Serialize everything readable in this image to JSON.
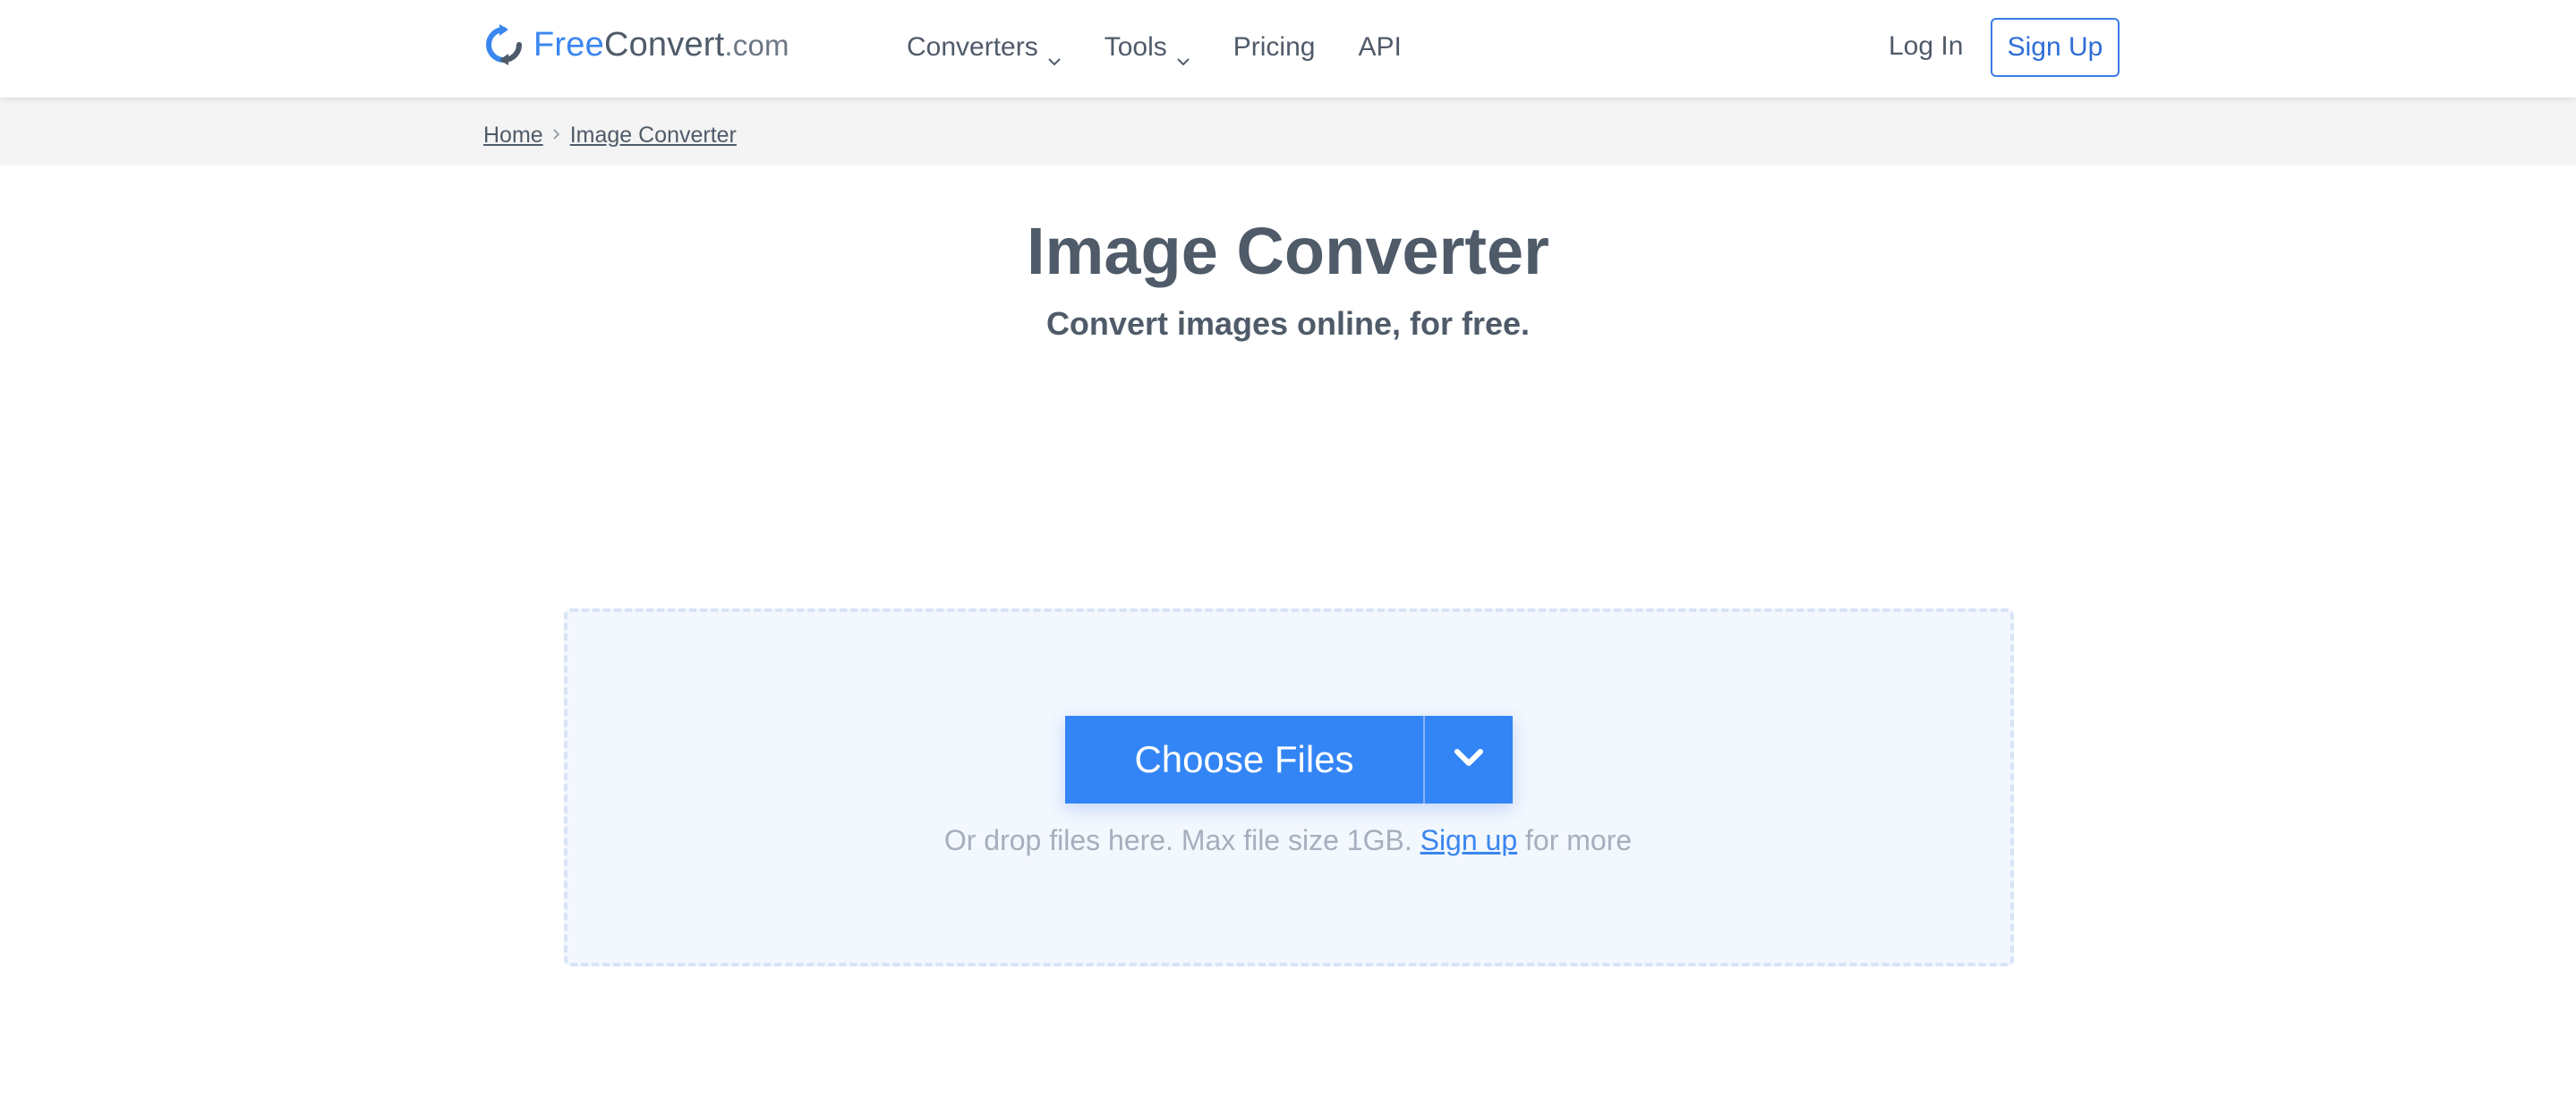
{
  "header": {
    "logo": {
      "free": "Free",
      "convert": "Convert",
      "domain": ".com"
    },
    "nav": [
      {
        "label": "Converters",
        "has_dropdown": true
      },
      {
        "label": "Tools",
        "has_dropdown": true
      },
      {
        "label": "Pricing",
        "has_dropdown": false
      },
      {
        "label": "API",
        "has_dropdown": false
      }
    ],
    "login_label": "Log In",
    "signup_label": "Sign Up"
  },
  "breadcrumb": {
    "items": [
      "Home",
      "Image Converter"
    ]
  },
  "hero": {
    "title": "Image Converter",
    "subtitle": "Convert images online, for free."
  },
  "dropzone": {
    "choose_label": "Choose Files",
    "hint_prefix": "Or drop files here. Max file size 1GB.",
    "hint_link": "Sign up",
    "hint_suffix": "for more"
  },
  "colors": {
    "brand_blue": "#3385f5",
    "text_gray": "#4f5b69",
    "hint_gray": "#a6afbc",
    "dropzone_bg": "#f3f7fe"
  },
  "icons": {
    "logo": "refresh-arrows-icon",
    "dropdown": "chevron-down-icon",
    "breadcrumb_separator": "chevron-right-icon"
  }
}
